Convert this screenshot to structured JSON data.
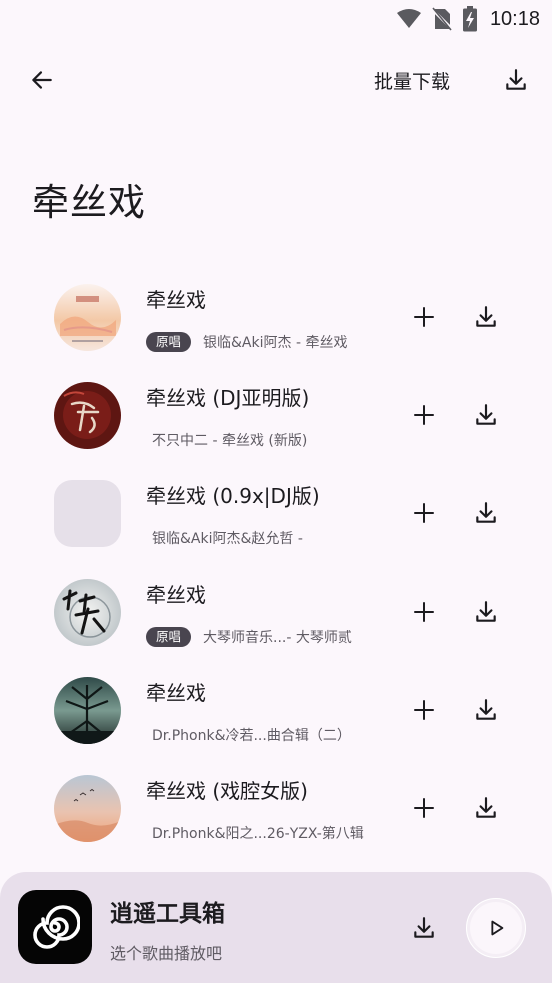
{
  "status_bar": {
    "time": "10:18",
    "icons": [
      "wifi-icon",
      "no-sim-icon",
      "battery-charging-icon"
    ]
  },
  "toolbar": {
    "back_icon": "arrow-left-icon",
    "batch_download_label": "批量下载",
    "download_icon": "download-icon"
  },
  "page": {
    "title": "牵丝戏"
  },
  "songs": [
    {
      "title": "牵丝戏",
      "badge": "原唱",
      "artist": "银临&Aki阿杰 - 牵丝戏",
      "cover": "cover-1"
    },
    {
      "title": "牵丝戏 (DJ亚明版)",
      "badge": "",
      "artist": "不只中二 - 牵丝戏 (新版)",
      "cover": "cover-2"
    },
    {
      "title": "牵丝戏 (0.9x|DJ版)",
      "badge": "",
      "artist": "银临&Aki阿杰&赵允哲 -",
      "cover": "placeholder"
    },
    {
      "title": "牵丝戏",
      "badge": "原唱",
      "artist": "大琴师音乐...- 大琴师贰",
      "cover": "cover-4"
    },
    {
      "title": "牵丝戏",
      "badge": "",
      "artist": "Dr.Phonk&冷若...曲合辑（二）",
      "cover": "cover-5"
    },
    {
      "title": "牵丝戏 (戏腔女版)",
      "badge": "",
      "artist": "Dr.Phonk&阳之...26-YZX-第八辑",
      "cover": "cover-6"
    }
  ],
  "player": {
    "title": "逍遥工具箱",
    "subtitle": "选个歌曲播放吧",
    "app_icon": "spiral-logo-icon",
    "download_icon": "download-icon",
    "play_icon": "play-icon"
  },
  "colors": {
    "background": "#fcf7fc",
    "player_bar": "#e8dfeb",
    "badge": "#49454f",
    "text_primary": "#1c1b1f",
    "text_secondary": "#5f5b63"
  }
}
